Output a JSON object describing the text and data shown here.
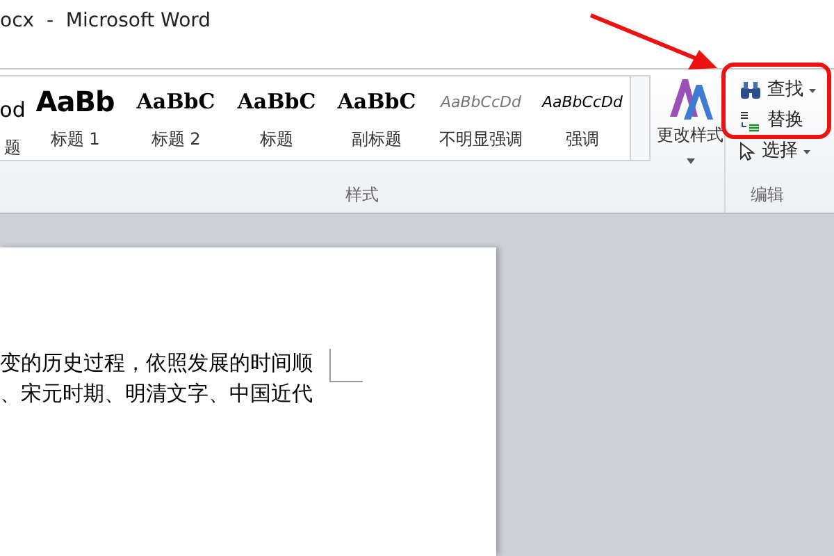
{
  "window": {
    "title": "ocx  -  Microsoft Word"
  },
  "styles_gallery": {
    "items": [
      {
        "kind": "normal",
        "preview": "od",
        "label": "题"
      },
      {
        "kind": "heading1",
        "preview": "AaBb",
        "label": "标题 1"
      },
      {
        "kind": "heading2",
        "preview": "AaBbC",
        "label": "标题 2"
      },
      {
        "kind": "title",
        "preview": "AaBbC",
        "label": "标题"
      },
      {
        "kind": "subtitle",
        "preview": "AaBbC",
        "label": "副标题"
      },
      {
        "kind": "subtle",
        "preview": "AaBbCcDd",
        "label": "不明显强调"
      },
      {
        "kind": "emphasis",
        "preview": "AaBbCcDd",
        "label": "强调"
      }
    ],
    "group_label": "样式"
  },
  "change_styles": {
    "label": "更改样式"
  },
  "editing": {
    "items": [
      {
        "kind": "find",
        "label": "查找"
      },
      {
        "kind": "replace",
        "label": "替换"
      },
      {
        "kind": "select",
        "label": "选择"
      }
    ],
    "group_label": "编辑",
    "highlight": true
  },
  "document": {
    "lines": [
      "变的历史过程，依照发展的时间顺",
      "、宋元时期、明清文字、中国近代"
    ]
  }
}
